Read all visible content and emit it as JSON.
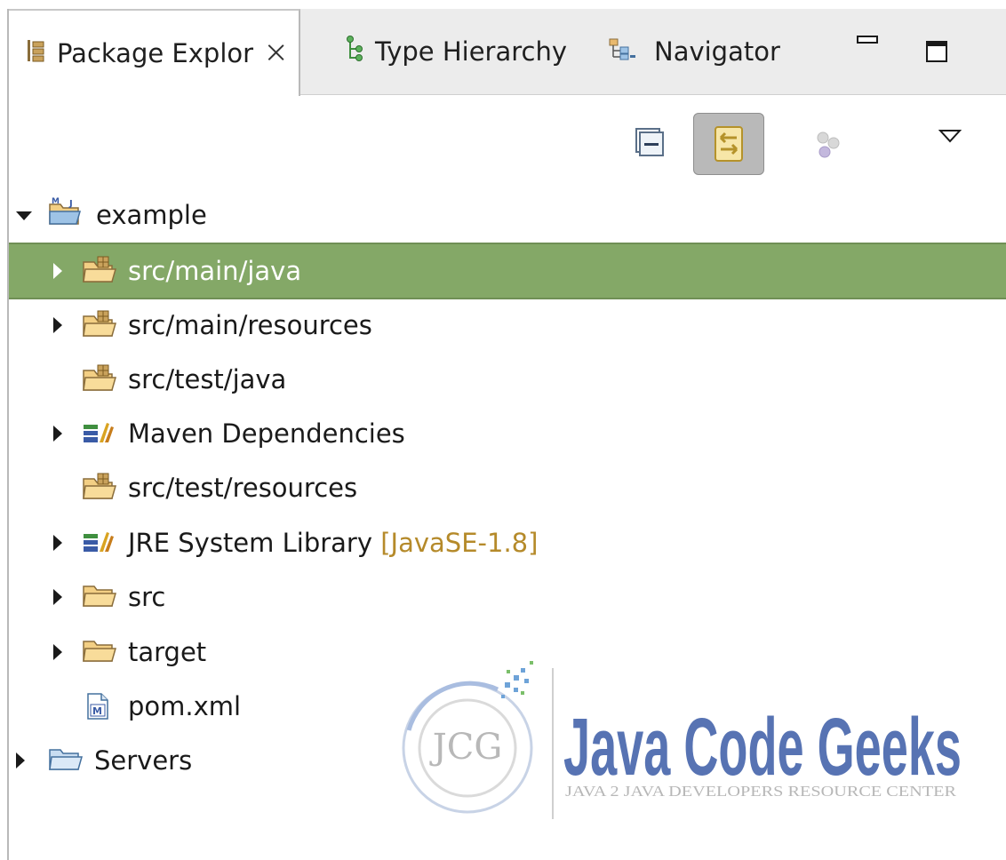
{
  "tabs": [
    {
      "label": "Package Explor",
      "icon": "package-explorer-icon",
      "active": true
    },
    {
      "label": "Type Hierarchy",
      "icon": "type-hierarchy-icon",
      "active": false
    },
    {
      "label": "Navigator",
      "icon": "navigator-icon",
      "active": false
    }
  ],
  "tab_close_glyph": "⨉",
  "tree": {
    "items": [
      {
        "label": "example",
        "icon": "maven-project-icon",
        "expanded": true
      },
      {
        "label": "src/main/java",
        "icon": "source-folder-icon",
        "selected": true
      },
      {
        "label": "src/main/resources",
        "icon": "source-folder-icon"
      },
      {
        "label": "src/test/java",
        "icon": "source-folder-icon"
      },
      {
        "label": "Maven Dependencies",
        "icon": "library-icon"
      },
      {
        "label": "src/test/resources",
        "icon": "source-folder-icon"
      },
      {
        "label": "JRE System Library",
        "decoration": "[JavaSE-1.8]",
        "icon": "library-icon"
      },
      {
        "label": "src",
        "icon": "folder-icon"
      },
      {
        "label": "target",
        "icon": "folder-icon"
      },
      {
        "label": "pom.xml",
        "icon": "maven-file-icon"
      },
      {
        "label": "Servers",
        "icon": "servers-folder-icon"
      }
    ]
  },
  "watermark": {
    "logo_text": "JCG",
    "brand_line1": "Java Code Geeks",
    "brand_line2": "JAVA 2 JAVA DEVELOPERS RESOURCE CENTER"
  },
  "colors": {
    "selection": "#84a867",
    "decoration": "#b58a2a",
    "folder": "#e9b96e",
    "brand": "#3a5ba6"
  }
}
